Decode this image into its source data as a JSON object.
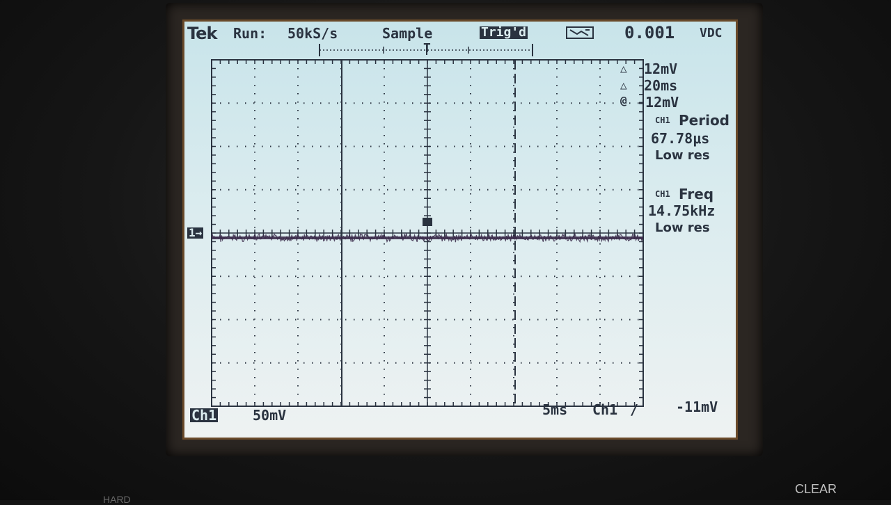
{
  "status_bar": {
    "brand": "Tek",
    "run_state": "Run:",
    "sample_rate": "50kS/s",
    "acq_mode": "Sample",
    "trigger_status": "Trig'd",
    "dc_reading": "0.001",
    "dc_unit": "VDC"
  },
  "cursors": {
    "delta_v": "12mV",
    "delta_t": "20ms",
    "at_v": "-12mV"
  },
  "measurements": [
    {
      "channel": "CH1",
      "name": "Period",
      "value": "67.78μs",
      "note": "Low res"
    },
    {
      "channel": "CH1",
      "name": "Freq",
      "value": "14.75kHz",
      "note": "Low res"
    }
  ],
  "bottom_bar": {
    "channel": "Ch1",
    "volts_div": "50mV",
    "time_div": "5ms",
    "trigger_source": "Ch1",
    "trigger_slope": "/",
    "trigger_level": "-11mV"
  },
  "ground_marker": "1→",
  "trigger_marker": "T",
  "hardware": {
    "clear_button": "CLEAR",
    "hard_label": "HARD"
  },
  "colors": {
    "screen_bg": "#dbecef",
    "text": "#2a3340",
    "trace": "#3a2a4a"
  }
}
